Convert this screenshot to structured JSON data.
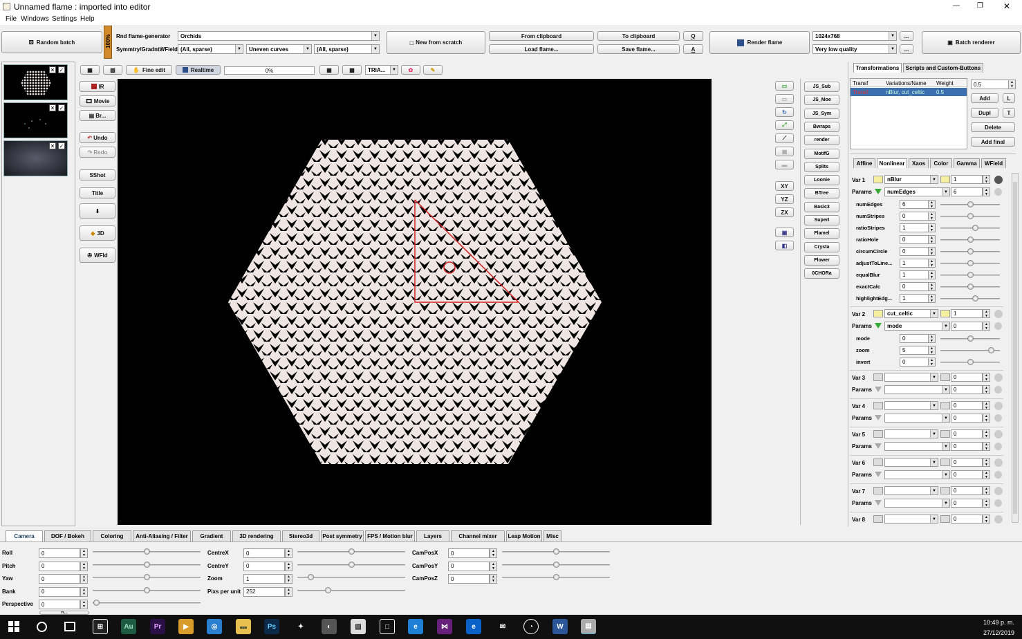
{
  "window": {
    "title": "Unnamed flame : imported into editor",
    "controls": [
      "—",
      "❐",
      "✕"
    ]
  },
  "menu": [
    "File",
    "Windows",
    "Settings",
    "Help"
  ],
  "toolbar": {
    "random_batch": "Random batch",
    "progress_vertical": "100%",
    "rnd_flame_generator_label": "Rnd flame-generator",
    "rnd_flame_generator_value": "Orchids",
    "symmetry_label": "Symmtry/GradntWField",
    "symmetry_value": "(All, sparse)",
    "curves_value": "Uneven curves",
    "wfield_value": "(All, sparse)",
    "new_from_scratch": "New from scratch",
    "from_clipboard": "From clipboard",
    "to_clipboard": "To clipboard",
    "load_flame": "Load flame...",
    "save_flame": "Save flame...",
    "q_button": "Q",
    "a_button": "A",
    "render_flame": "Render flame",
    "resolution": "1024x768",
    "quality": "Very low quality",
    "ellipsis": "...",
    "batch_renderer": "Batch renderer"
  },
  "editor_toolbar": {
    "fine_edit": "Fine edit",
    "realtime": "Realtime",
    "progress": "0%",
    "progress_value": 0,
    "tria": "TRIA..."
  },
  "left_tools": {
    "ir": "IR",
    "movie": "Movie",
    "br": "Br...",
    "undo": "Undo",
    "redo": "Redo",
    "sshot": "SShot",
    "title": "Title",
    "three_d": "3D",
    "wfld": "WFld"
  },
  "axis_buttons": [
    "XY",
    "YZ",
    "ZX"
  ],
  "script_buttons": [
    "JS_Sub",
    "JS_Moe",
    "JS_Sym",
    "Bwraps",
    "render",
    "MotifG",
    "Splits",
    "Loonie",
    "BTree",
    "Basic3",
    "SuperI",
    "Flamel",
    "Crysta",
    "Flower",
    "0CHORa"
  ],
  "right_tabs": [
    "Transformations",
    "Scripts and Custom-Buttons"
  ],
  "transform_table": {
    "headers": [
      "Transf",
      "Variations/Name",
      "Weight"
    ],
    "rows": [
      [
        "Transf",
        "nBlur, cut_celtic",
        "0.5"
      ]
    ]
  },
  "transform_buttons": {
    "weight_value": "0.5",
    "add": "Add",
    "l": "L",
    "dupl": "Dupl",
    "t": "T",
    "delete": "Delete",
    "add_final": "Add final"
  },
  "sub_tabs": [
    "Affine",
    "Nonlinear",
    "Xaos",
    "Color",
    "Gamma",
    "WField"
  ],
  "variations": [
    {
      "label": "Var 1",
      "name": "nBlur",
      "amount": "1",
      "params_label": "Params",
      "param_select": "numEdges",
      "param_value": "6",
      "params": [
        {
          "name": "numEdges",
          "value": "6",
          "knob": 0.5
        },
        {
          "name": "numStripes",
          "value": "0",
          "knob": 0.5
        },
        {
          "name": "ratioStripes",
          "value": "1",
          "knob": 0.58
        },
        {
          "name": "ratioHole",
          "value": "0",
          "knob": 0.5
        },
        {
          "name": "circumCircle",
          "value": "0",
          "knob": 0.5
        },
        {
          "name": "adjustToLine...",
          "value": "1",
          "knob": 0.5
        },
        {
          "name": "equalBlur",
          "value": "1",
          "knob": 0.5
        },
        {
          "name": "exactCalc",
          "value": "0",
          "knob": 0.5
        },
        {
          "name": "highlightEdg...",
          "value": "1",
          "knob": 0.58
        }
      ]
    },
    {
      "label": "Var 2",
      "name": "cut_celtic",
      "amount": "1",
      "params_label": "Params",
      "param_select": "mode",
      "param_value": "0",
      "params": [
        {
          "name": "mode",
          "value": "0",
          "knob": 0.5
        },
        {
          "name": "zoom",
          "value": "5",
          "knob": 0.85
        },
        {
          "name": "invert",
          "value": "0",
          "knob": 0.5
        }
      ]
    },
    {
      "label": "Var 3",
      "name": "",
      "amount": "0",
      "params_label": "Params",
      "param_value": "0"
    },
    {
      "label": "Var 4",
      "name": "",
      "amount": "0",
      "params_label": "Params",
      "param_value": "0"
    },
    {
      "label": "Var 5",
      "name": "",
      "amount": "0",
      "params_label": "Params",
      "param_value": "0"
    },
    {
      "label": "Var 6",
      "name": "",
      "amount": "0",
      "params_label": "Params",
      "param_value": "0"
    },
    {
      "label": "Var 7",
      "name": "",
      "amount": "0",
      "params_label": "Params",
      "param_value": "0"
    },
    {
      "label": "Var 8",
      "name": "",
      "amount": "0"
    }
  ],
  "bottom_tabs": [
    "Camera",
    "DOF / Bokeh",
    "Coloring",
    "Anti-Aliasing / Filter",
    "Gradient",
    "3D rendering",
    "Stereo3d",
    "Post symmetry",
    "FPS / Motion blur",
    "Layers",
    "Channel mixer",
    "Leap Motion",
    "Misc"
  ],
  "camera": {
    "col1": [
      {
        "label": "Roll",
        "value": "0",
        "knob": 0.5
      },
      {
        "label": "Pitch",
        "value": "0",
        "knob": 0.5
      },
      {
        "label": "Yaw",
        "value": "0",
        "knob": 0.5
      },
      {
        "label": "Bank",
        "value": "0",
        "knob": 0.5
      },
      {
        "label": "Perspective",
        "value": "0",
        "knob": 0.03
      }
    ],
    "col2": [
      {
        "label": "CentreX",
        "value": "0",
        "knob": 0.5
      },
      {
        "label": "CentreY",
        "value": "0",
        "knob": 0.5
      },
      {
        "label": "Zoom",
        "value": "1",
        "knob": 0.12
      },
      {
        "label": "Pixs per unit",
        "value": "252",
        "knob": 0.28
      }
    ],
    "col3": [
      {
        "label": "CamPosX",
        "value": "0",
        "knob": 0.5
      },
      {
        "label": "CamPosY",
        "value": "0",
        "knob": 0.5
      },
      {
        "label": "CamPosZ",
        "value": "0",
        "knob": 0.5
      }
    ],
    "reset_partial": "R..."
  },
  "taskbar": {
    "time": "10:49 p. m.",
    "date": "27/12/2019",
    "apps": [
      {
        "name": "Au",
        "color": "#1d5b43"
      },
      {
        "name": "Pr",
        "color": "#2a1046"
      },
      {
        "name": "Ps",
        "color": "#0b2a4a"
      },
      {
        "name": "W",
        "color": "#2b579a"
      }
    ]
  },
  "accent": "#3b6fb0"
}
